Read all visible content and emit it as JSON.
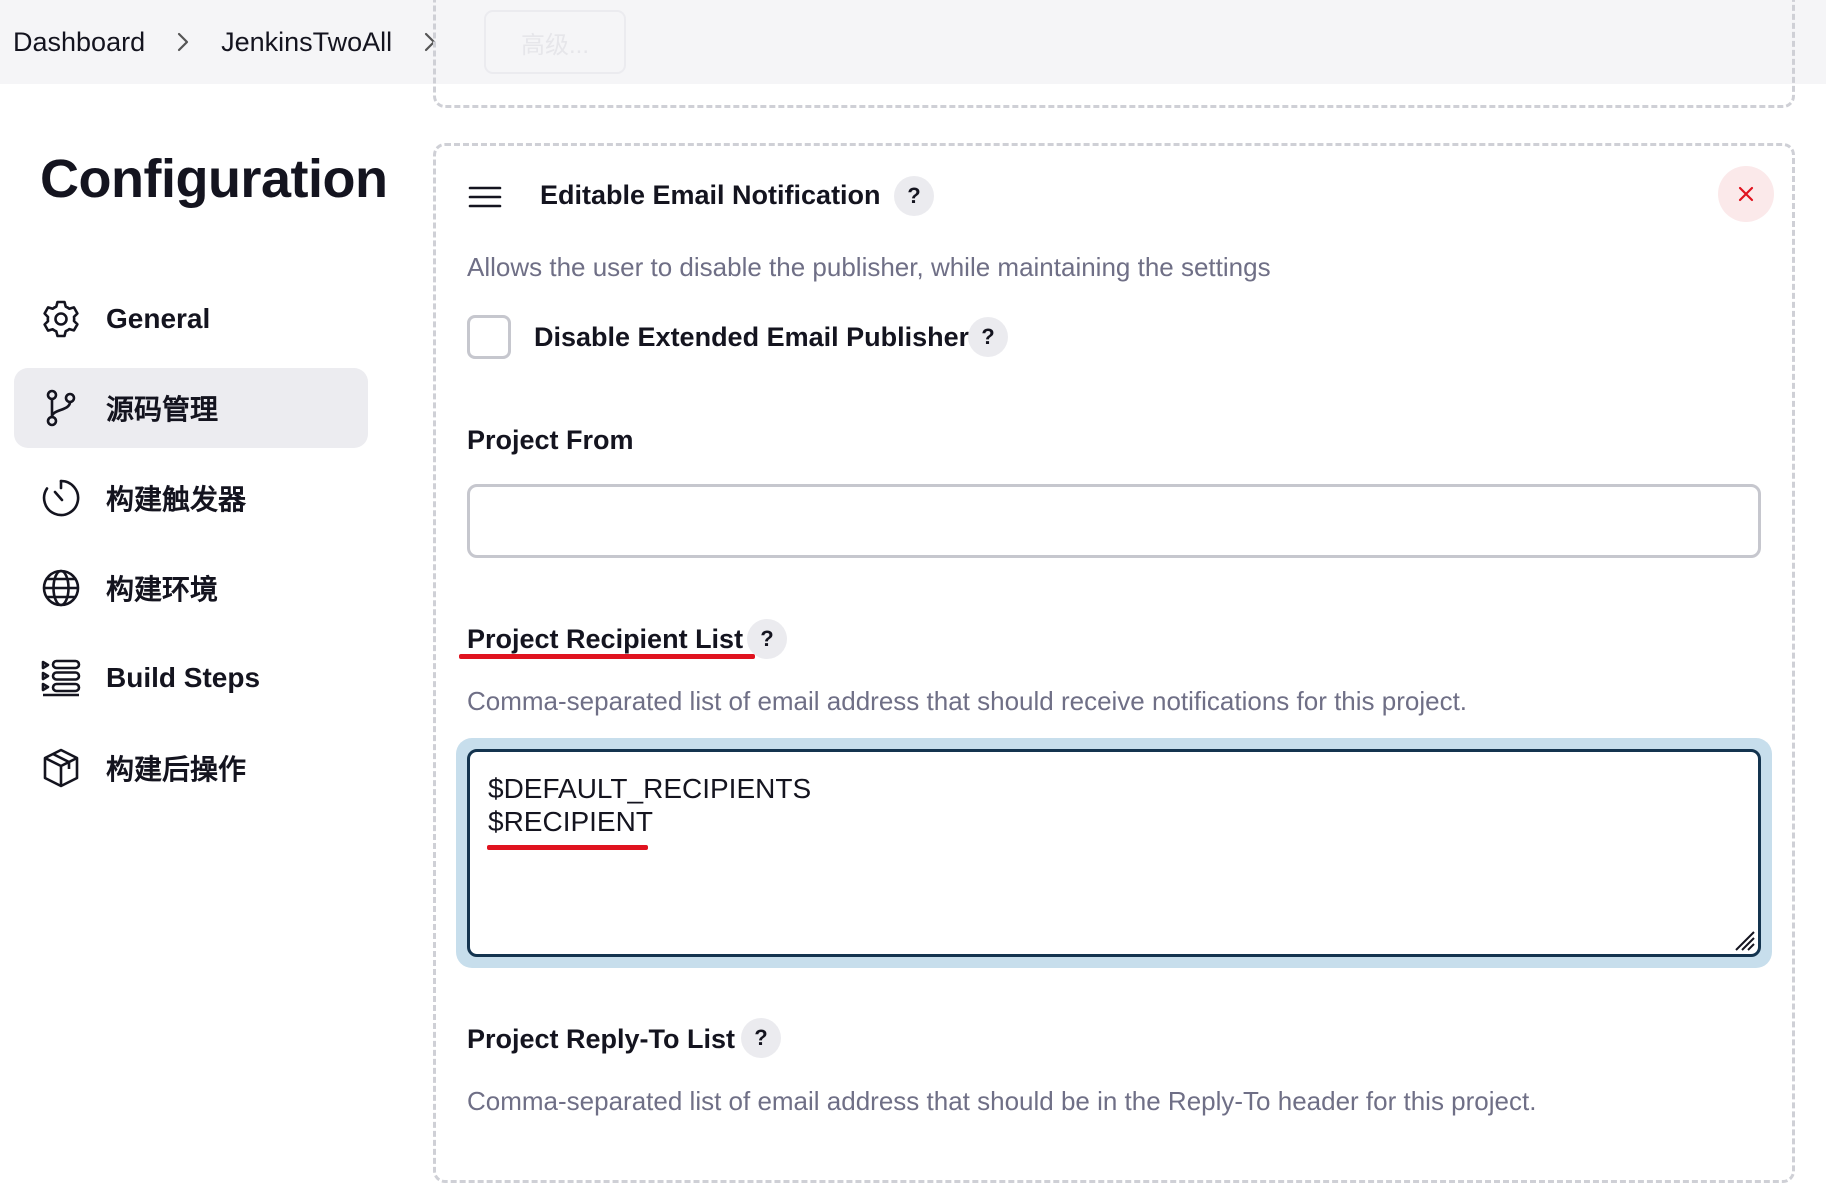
{
  "breadcrumb": {
    "items": [
      "Dashboard",
      "JenkinsTwoAll"
    ],
    "advanced_button": "高级..."
  },
  "sidebar": {
    "title": "Configuration",
    "items": [
      {
        "label": "General",
        "icon": "gear-icon"
      },
      {
        "label": "源码管理",
        "icon": "branch-icon",
        "active": true
      },
      {
        "label": "构建触发器",
        "icon": "clock-icon"
      },
      {
        "label": "构建环境",
        "icon": "globe-icon"
      },
      {
        "label": "Build Steps",
        "icon": "list-steps-icon"
      },
      {
        "label": "构建后操作",
        "icon": "package-icon"
      }
    ]
  },
  "section": {
    "title": "Editable Email Notification",
    "description": "Allows the user to disable the publisher, while maintaining the settings",
    "disable_checkbox": {
      "label": "Disable Extended Email Publisher",
      "checked": false
    },
    "project_from": {
      "label": "Project From",
      "value": ""
    },
    "recipient_list": {
      "label": "Project Recipient List",
      "description": "Comma-separated list of email address that should receive notifications for this project.",
      "lines": [
        "$DEFAULT_RECIPIENTS",
        "$RECIPIENT"
      ]
    },
    "reply_to": {
      "label": "Project Reply-To List",
      "description": "Comma-separated list of email address that should be in the Reply-To header for this project."
    },
    "help_glyph": "?"
  },
  "colors": {
    "annotation_red": "#e0131f",
    "focus_ring": "#c7deec",
    "close_red": "#e0131f"
  }
}
